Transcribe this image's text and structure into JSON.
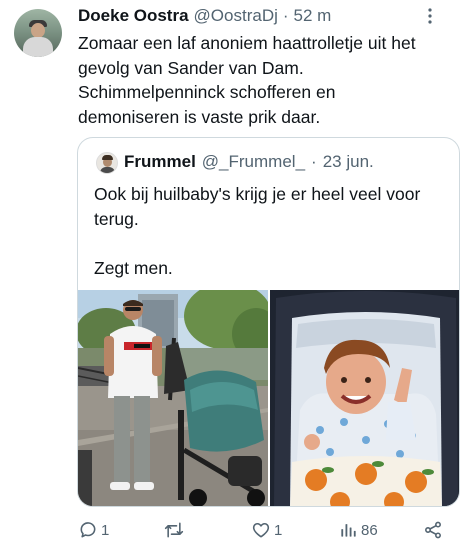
{
  "tweet": {
    "author_name": "Doeke Oostra",
    "handle": "@OostraDj",
    "separator": "·",
    "time": "52 m",
    "lines": [
      "Zomaar een laf anoniem haattrolletje uit het",
      "gevolg van Sander van Dam.",
      "Schimmelpenninck schofferen en",
      "demoniseren is vaste prik daar."
    ]
  },
  "quote": {
    "author_name": "Frummel",
    "handle": "@_Frummel_",
    "separator": "·",
    "date": "23 jun.",
    "lines": [
      "Ook bij huilbaby's krijg je er heel veel voor",
      "terug.",
      "",
      "Zegt men."
    ],
    "photo1_shirt_text": "DIESEL"
  },
  "actions": {
    "reply_count": "1",
    "retweet_count": "",
    "like_count": "1",
    "views_count": "86"
  },
  "colors": {
    "text": "#0f1419",
    "secondary": "#536471",
    "border": "#cfd9de"
  },
  "icons": [
    "more-icon",
    "reply-icon",
    "retweet-icon",
    "like-icon",
    "views-icon",
    "share-icon"
  ]
}
